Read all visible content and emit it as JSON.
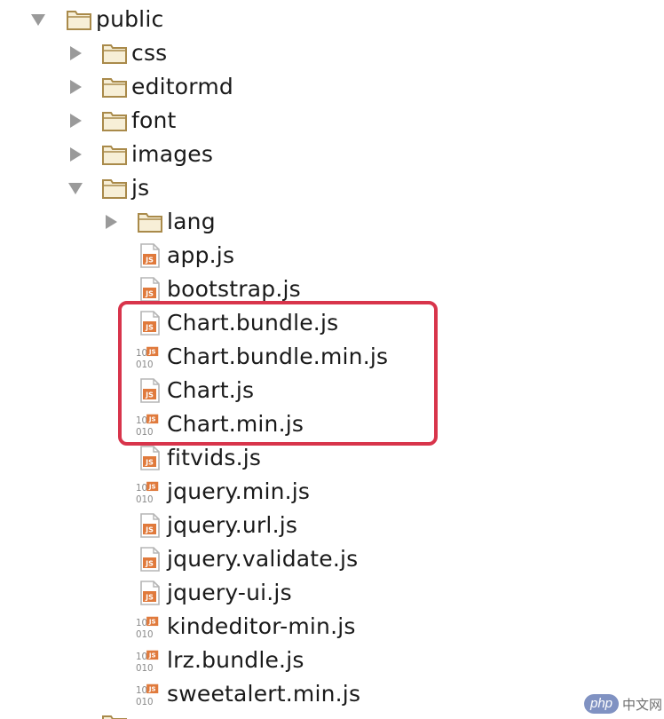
{
  "colors": {
    "folder_stroke": "#a98a4a",
    "folder_fill": "#f7efd7",
    "arrow": "#9a9a9a",
    "js_badge": "#e07a3c",
    "file_page": "#b5b5b5",
    "highlight_border": "#d8344b"
  },
  "tree": {
    "items": [
      {
        "label": "public",
        "kind": "folder",
        "expanded": true,
        "icon": "folder-icon"
      },
      {
        "label": "css",
        "kind": "folder",
        "expanded": false,
        "icon": "folder-icon"
      },
      {
        "label": "editormd",
        "kind": "folder",
        "expanded": false,
        "icon": "folder-icon"
      },
      {
        "label": "font",
        "kind": "folder",
        "expanded": false,
        "icon": "folder-icon"
      },
      {
        "label": "images",
        "kind": "folder",
        "expanded": false,
        "icon": "folder-icon"
      },
      {
        "label": "js",
        "kind": "folder",
        "expanded": true,
        "icon": "folder-icon"
      },
      {
        "label": "lang",
        "kind": "folder",
        "expanded": false,
        "icon": "folder-icon"
      },
      {
        "label": "app.js",
        "kind": "js-file",
        "icon": "js-file-icon"
      },
      {
        "label": "bootstrap.js",
        "kind": "js-file",
        "icon": "js-file-icon"
      },
      {
        "label": "Chart.bundle.js",
        "kind": "js-file",
        "icon": "js-file-icon"
      },
      {
        "label": "Chart.bundle.min.js",
        "kind": "min-js-file",
        "icon": "minified-js-file-icon"
      },
      {
        "label": "Chart.js",
        "kind": "js-file",
        "icon": "js-file-icon"
      },
      {
        "label": "Chart.min.js",
        "kind": "min-js-file",
        "icon": "minified-js-file-icon"
      },
      {
        "label": "fitvids.js",
        "kind": "js-file",
        "icon": "js-file-icon"
      },
      {
        "label": "jquery.min.js",
        "kind": "min-js-file",
        "icon": "minified-js-file-icon"
      },
      {
        "label": "jquery.url.js",
        "kind": "js-file",
        "icon": "js-file-icon"
      },
      {
        "label": "jquery.validate.js",
        "kind": "js-file",
        "icon": "js-file-icon"
      },
      {
        "label": "jquery-ui.js",
        "kind": "js-file",
        "icon": "js-file-icon"
      },
      {
        "label": "kindeditor-min.js",
        "kind": "min-js-file",
        "icon": "minified-js-file-icon"
      },
      {
        "label": "lrz.bundle.js",
        "kind": "min-js-file",
        "icon": "minified-js-file-icon"
      },
      {
        "label": "sweetalert.min.js",
        "kind": "min-js-file",
        "icon": "minified-js-file-icon"
      }
    ]
  },
  "icon_text": {
    "js_badge": "JS",
    "binary_top": "10",
    "binary_bottom": "010"
  },
  "watermark": {
    "badge": "php",
    "text": "中文网"
  }
}
